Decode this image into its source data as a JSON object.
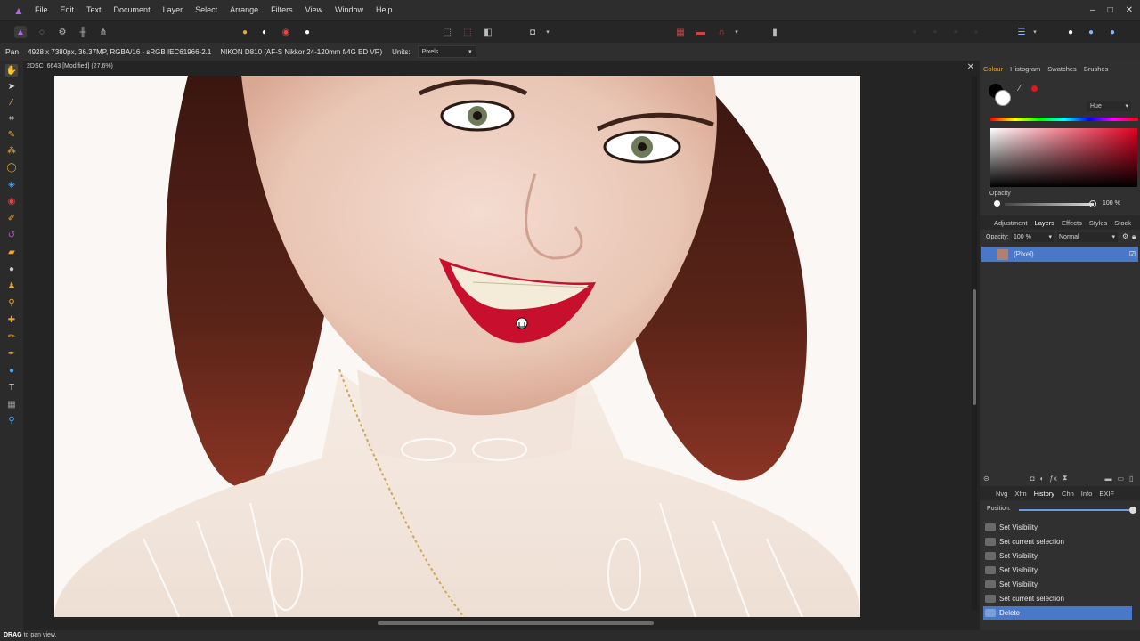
{
  "menu": {
    "items": [
      "File",
      "Edit",
      "Text",
      "Document",
      "Layer",
      "Select",
      "Arrange",
      "Filters",
      "View",
      "Window",
      "Help"
    ]
  },
  "window_controls": [
    "–",
    "□",
    "✕"
  ],
  "context_bar": {
    "tool": "Pan",
    "info": "4928 x 7380px, 36.37MP, RGBA/16 - sRGB IEC61966-2.1",
    "camera": "NIKON D810 (AF-S Nikkor 24-120mm f/4G ED VR)",
    "units_label": "Units:",
    "units_value": "Pixels"
  },
  "document": {
    "tab_title": "2DSC_6643 [Modified] (27.6%)"
  },
  "right_panel": {
    "colour_tabs": [
      "Colour",
      "Histogram",
      "Swatches",
      "Brushes"
    ],
    "colour_mode": "Hue",
    "opacity_label": "Opacity",
    "opacity_value": "100 %",
    "layers_tabs": [
      "Adjustment",
      "Layers",
      "Effects",
      "Styles",
      "Stock"
    ],
    "layers_opacity_label": "Opacity:",
    "layers_opacity_value": "100 %",
    "blend_mode": "Normal",
    "layer_name": "(Pixel)",
    "bottom_tabs": [
      "Nvg",
      "Xfm",
      "History",
      "Chn",
      "Info",
      "EXIF"
    ],
    "position_label": "Position:",
    "history": [
      "Set Visibility",
      "Set current selection",
      "Set Visibility",
      "Set Visibility",
      "Set Visibility",
      "Set current selection",
      "Delete"
    ]
  },
  "status": {
    "action": "DRAG",
    "message": "to pan view."
  },
  "colors": {
    "accent": "#4a78c8",
    "panel_bg": "#303030",
    "primary_colour": "#ffffff",
    "secondary_colour": "#000000",
    "picked_colour": "#e01818"
  }
}
